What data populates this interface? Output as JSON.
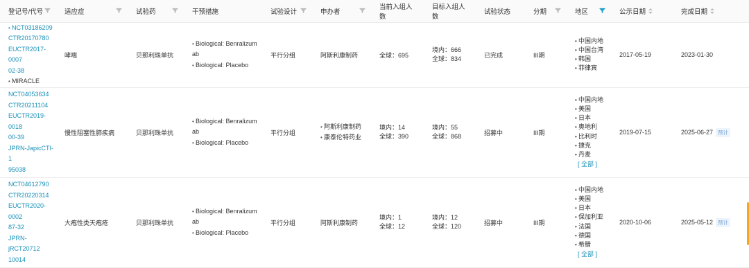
{
  "columns": {
    "reg": "登记号/代号",
    "indication": "适应症",
    "drug": "试验药",
    "intervention": "干预措施",
    "design": "试验设计",
    "sponsor": "申办者",
    "current": "当前入组人数",
    "target": "目标入组人数",
    "status": "试验状态",
    "phase": "分期",
    "region": "地区",
    "pub_date": "公示日期",
    "end_date": "完成日期"
  },
  "rows": [
    {
      "ids": [
        "NCT03186209",
        "CTR20170780",
        "EUCTR2017-0007",
        "02-38"
      ],
      "alias": "MIRACLE",
      "indication": "哮喘",
      "drug": "贝那利珠单抗",
      "interventions": [
        "Biological: Benralizum",
        "ab",
        "Biological: Placebo"
      ],
      "design": "平行分组",
      "sponsors": [
        "阿斯利康制药"
      ],
      "current": [
        "全球：695"
      ],
      "target": [
        "境内：666",
        "全球：834"
      ],
      "status": "已完成",
      "phase": "III期",
      "regions": [
        "中国内地",
        "中国台湾",
        "韩国",
        "菲律宾"
      ],
      "more": "",
      "pub_date": "2017-05-19",
      "end_date": "2023-01-30",
      "end_tag": ""
    },
    {
      "ids": [
        "NCT04053634",
        "CTR20211104",
        "EUCTR2019-0018",
        "00-39",
        "JPRN-JapicCTI-1",
        "95038"
      ],
      "alias": "",
      "indication": "慢性阻塞性肺疾病",
      "drug": "贝那利珠单抗",
      "interventions": [
        "Biological: Benralizum",
        "ab",
        "Biological: Placebo"
      ],
      "design": "平行分组",
      "sponsors": [
        "阿斯利康制药",
        "康泰伦特药业"
      ],
      "current": [
        "境内：14",
        "全球：390"
      ],
      "target": [
        "境内：55",
        "全球：868"
      ],
      "status": "招募中",
      "phase": "III期",
      "regions": [
        "中国内地",
        "美国",
        "日本",
        "奥地利",
        "比利时",
        "捷克",
        "丹麦"
      ],
      "more": "[ 全部 ]",
      "pub_date": "2019-07-15",
      "end_date": "2025-06-27",
      "end_tag": "预计"
    },
    {
      "ids": [
        "NCT04612790",
        "CTR20220314",
        "EUCTR2020-0002",
        "87-32",
        "JPRN-jRCT20712",
        "10014"
      ],
      "alias": "",
      "indication": "大疱性类天疱疮",
      "drug": "贝那利珠单抗",
      "interventions": [
        "Biological: Benralizum",
        "ab",
        "Biological: Placebo"
      ],
      "design": "平行分组",
      "sponsors": [
        "阿斯利康制药"
      ],
      "current": [
        "境内：1",
        "全球：12"
      ],
      "target": [
        "境内：12",
        "全球：120"
      ],
      "status": "招募中",
      "phase": "III期",
      "regions": [
        "中国内地",
        "美国",
        "日本",
        "保加利亚",
        "法国",
        "德国",
        "希腊"
      ],
      "more": "[ 全部 ]",
      "pub_date": "2020-10-06",
      "end_date": "2025-05-12",
      "end_tag": "预计"
    }
  ],
  "colors": {
    "link": "#1890b8",
    "active_filter": "#1aa0c8",
    "scroll": "#f5a623"
  }
}
